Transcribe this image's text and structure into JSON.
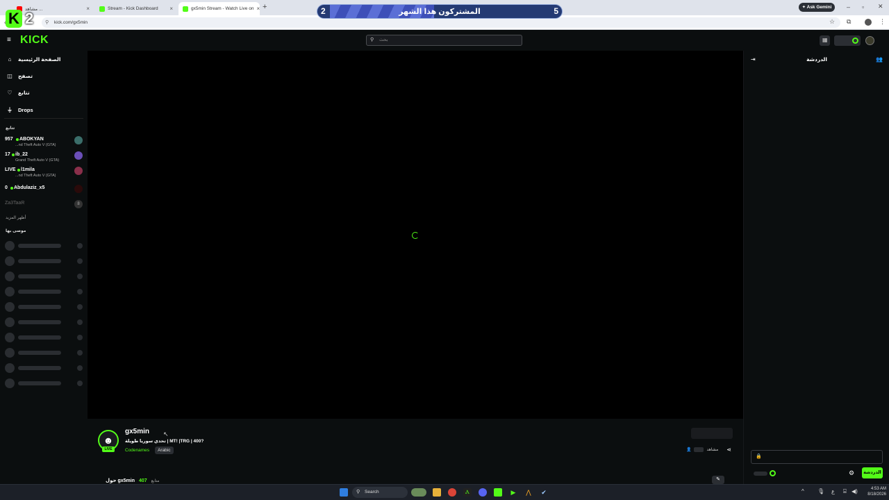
{
  "browser": {
    "tabs": [
      {
        "title": "مشاهد ...",
        "fav_color": "#ff0000"
      },
      {
        "title": "Stream - Kick Dashboard",
        "fav_color": "#53fc18"
      },
      {
        "title": "gx5min Stream - Watch Live on",
        "fav_color": "#53fc18"
      }
    ],
    "url": "kick.com/gx5min",
    "gemini_label": "Ask Gemini"
  },
  "overlay": {
    "k_letter": "K",
    "k_number": "2",
    "sub_left": "2",
    "sub_right": "5",
    "sub_text": "المشتركون هذا الشهر"
  },
  "header": {
    "logo": "KICK",
    "search_placeholder": "بحث"
  },
  "sidebar": {
    "nav": [
      {
        "label": "الصفحة الرئيسية",
        "icon": "home-icon"
      },
      {
        "label": "تصفح",
        "icon": "browse-icon"
      },
      {
        "label": "تتابع",
        "icon": "heart-icon"
      },
      {
        "label": "Drops",
        "icon": "drops-icon"
      }
    ],
    "following_label": "تتابع",
    "channels": [
      {
        "count": "957",
        "name": "ABOKYAN",
        "game": "...nd Theft Auto V (GTA)",
        "avatar_color": "#3b6e6a"
      },
      {
        "count": "17",
        "name": "ib_22",
        "game": "Grand Theft Auto V (GTA)",
        "avatar_color": "#6b4fb8"
      },
      {
        "count": "LIVE",
        "name": "l1mila",
        "game": "...nd Theft Auto V (GTA)",
        "avatar_color": "#8a2f4a"
      },
      {
        "count": "0",
        "name": "Abdulaziz_x5",
        "game": "",
        "avatar_color": "#2a0a0a"
      }
    ],
    "offline_channel": {
      "name": "Za3TaaR",
      "avatar_letter": "8"
    },
    "show_more": "أظهر المزيد",
    "recommended_label": "موصى بها"
  },
  "stream": {
    "username": "gx5min",
    "title": "تحدي سوريا طويلة | MT! |TRG | 400?",
    "category": "Codenames",
    "language": "Arabic",
    "live_badge": "LIVE",
    "viewers_label": "مشاهد",
    "about_name": "حول gx5min",
    "followers_count": "407",
    "followers_label": "متابع"
  },
  "chat": {
    "title": "الدردشة",
    "send_label": "الدردشة"
  },
  "taskbar": {
    "search_label": "Search",
    "time": "4:53 AM",
    "date": "8/18/2026",
    "lang": "ع"
  },
  "colors": {
    "accent": "#53fc18",
    "background": "#0b0e0f"
  }
}
